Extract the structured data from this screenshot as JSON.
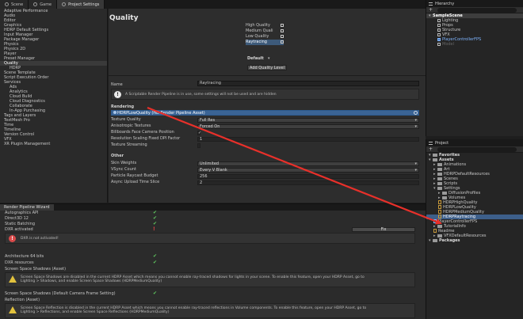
{
  "tabs": [
    {
      "label": "Scene",
      "icon": "grid-icon"
    },
    {
      "label": "Game",
      "icon": "gamepad-icon"
    },
    {
      "label": "Project Settings",
      "icon": "gear-icon"
    }
  ],
  "settings_nav": [
    "Adaptive Performance",
    "Audio",
    "Editor",
    "Graphics",
    "HDRP Default Settings",
    "Input Manager",
    "Package Manager",
    "Physics",
    "Physics 2D",
    "Player",
    "Preset Manager",
    "Quality",
    "HDRP",
    "Scene Template",
    "Script Execution Order",
    "Services",
    "Ads",
    "Analytics",
    "Cloud Build",
    "Cloud Diagnostics",
    "Collaborate",
    "In-App Purchasing",
    "Tags and Layers",
    "TextMesh Pro",
    "Time",
    "Timeline",
    "Version Control",
    "VFX",
    "XR Plugin Management"
  ],
  "quality": {
    "title": "Quality",
    "levels": [
      "High Quality",
      "Medium Quali",
      "Low Quality",
      "Raytracing"
    ],
    "default_label": "Default",
    "add_button": "Add Quality Level",
    "name_label": "Name",
    "name_value": "Raytracing",
    "info": "A Scriptable Render Pipeline is in use, some settings will not be used and are hidden",
    "rendering_header": "Rendering",
    "asset_value": "HDRPLowQuality (HD Render Pipeline Asset)",
    "props": [
      {
        "label": "Texture Quality",
        "value": "Full Res"
      },
      {
        "label": "Anisotropic Textures",
        "value": "Forced On"
      },
      {
        "label": "Billboards Face Camera Position",
        "value": "✓"
      },
      {
        "label": "Resolution Scaling Fixed DPI Factor",
        "value": "1"
      },
      {
        "label": "Texture Streaming",
        "value": ""
      }
    ],
    "other_header": "Other",
    "other_props": [
      {
        "label": "Skin Weights",
        "value": "Unlimited"
      },
      {
        "label": "VSync Count",
        "value": "Every V Blank"
      },
      {
        "label": "Particle Raycast Budget",
        "value": "256"
      },
      {
        "label": "Async Upload Time Slice",
        "value": "2"
      }
    ]
  },
  "hierarchy": {
    "title": "Hierarchy",
    "scene": "SampleScene",
    "items": [
      "Lighting",
      "Props",
      "Structure",
      "VFX",
      "PlayerControllerFPS",
      "Model"
    ]
  },
  "project": {
    "title": "Project",
    "items": [
      {
        "label": "Favorites",
        "kind": "header"
      },
      {
        "label": "Assets",
        "kind": "header"
      },
      {
        "label": "Animations",
        "kind": "folder",
        "depth": 1
      },
      {
        "label": "Art",
        "kind": "folder",
        "depth": 1
      },
      {
        "label": "HDRPDefaultResources",
        "kind": "folder",
        "depth": 1
      },
      {
        "label": "Scenes",
        "kind": "folder",
        "depth": 1
      },
      {
        "label": "Scripts",
        "kind": "folder",
        "depth": 1
      },
      {
        "label": "Settings",
        "kind": "folder",
        "depth": 1
      },
      {
        "label": "DiffusionProfiles",
        "kind": "folder",
        "depth": 2
      },
      {
        "label": "Volumes",
        "kind": "folder",
        "depth": 2
      },
      {
        "label": "HDRPHighQuality",
        "kind": "asset",
        "depth": 2
      },
      {
        "label": "HDRPLowQuality",
        "kind": "asset",
        "depth": 2
      },
      {
        "label": "HDRPMediumQuality",
        "kind": "asset",
        "depth": 2
      },
      {
        "label": "HDRPRaytracing",
        "kind": "asset",
        "depth": 2
      },
      {
        "label": "PlayerControllerFPS",
        "kind": "prefab",
        "depth": 1
      },
      {
        "label": "TutorialInfo",
        "kind": "folder",
        "depth": 1
      },
      {
        "label": "Readme",
        "kind": "asset",
        "depth": 1
      },
      {
        "label": "VFXDefaultResources",
        "kind": "folder",
        "depth": 1
      },
      {
        "label": "Packages",
        "kind": "header"
      }
    ]
  },
  "wizard": {
    "title": "Render Pipeline Wizard",
    "rows": [
      {
        "label": "Autographics API",
        "status": "ok"
      },
      {
        "label": "Direct3D 12",
        "status": "ok"
      },
      {
        "label": "Static Batching",
        "status": "ok"
      },
      {
        "label": "DXR activated",
        "status": "warn"
      }
    ],
    "fix_button": "Fix",
    "dxr_error": "DXR is not activated!",
    "rows2": [
      {
        "label": "Architecture 64 bits",
        "status": "ok"
      },
      {
        "label": "DXR resources",
        "status": "ok"
      },
      {
        "label": "Screen Space Shadows (Asset)",
        "status": "warn"
      }
    ],
    "shadows_msg_1": "Screen Space Shadows are disabled in the current HDRP Asset which means you cannot enable ray-traced shadows for lights in your scene. To enable this feature, open your HDRP Asset, go to",
    "shadows_msg_2": "Lighting > Shadows, and enable Screen Space Shadows (HDRPMediumQuality)",
    "rows3": [
      {
        "label": "Screen Space Shadows (Default Camera Frame Setting)",
        "status": "ok"
      },
      {
        "label": "Reflection (Asset)",
        "status": "warn"
      }
    ],
    "refl_msg_1": "Screen Space Reflection is disabled in the current HDRP Asset which means you cannot enable ray-traced reflections in Volume components. To enable this feature, open your HDRP Asset, go to",
    "refl_msg_2": "Lighting > Reflections, and enable Screen Space Reflections (HDRPMediumQuality)"
  },
  "colors": {
    "annotation_arrow": "#e8302a",
    "selection": "#3d5f8a"
  }
}
